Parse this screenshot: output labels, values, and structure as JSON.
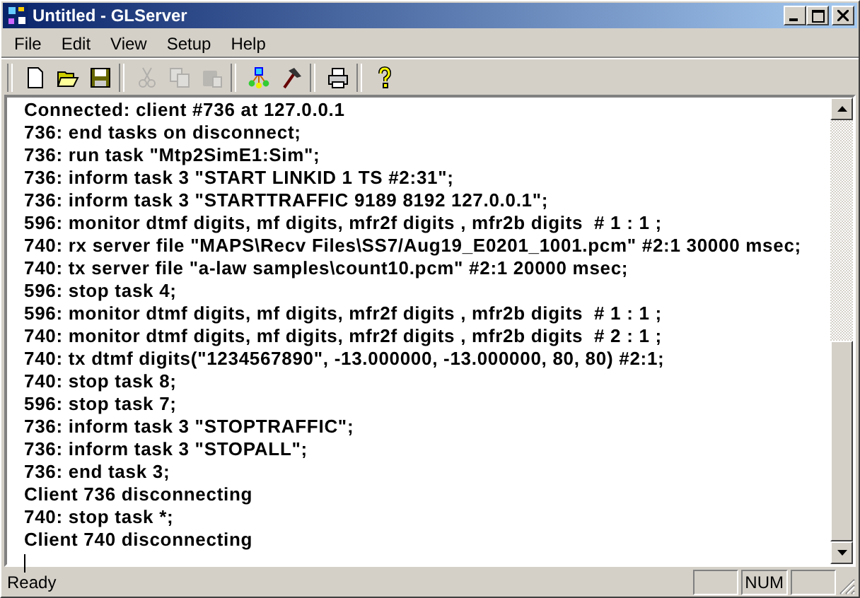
{
  "window": {
    "title": "Untitled - GLServer"
  },
  "menu": [
    "File",
    "Edit",
    "View",
    "Setup",
    "Help"
  ],
  "toolbar": [
    [
      {
        "kind": "new",
        "disabled": false
      },
      {
        "kind": "open",
        "disabled": false
      },
      {
        "kind": "save",
        "disabled": false
      }
    ],
    [
      {
        "kind": "cut",
        "disabled": true
      },
      {
        "kind": "copy",
        "disabled": true
      },
      {
        "kind": "paste",
        "disabled": true
      }
    ],
    [
      {
        "kind": "network",
        "disabled": false
      },
      {
        "kind": "hammer",
        "disabled": false
      }
    ],
    [
      {
        "kind": "print",
        "disabled": false
      }
    ],
    [
      {
        "kind": "help",
        "disabled": false
      }
    ]
  ],
  "log": [
    "Connected: client #736 at 127.0.0.1",
    "736: end tasks on disconnect;",
    "736: run task \"Mtp2SimE1:Sim\";",
    "736: inform task 3 \"START LINKID 1 TS #2:31\";",
    "736: inform task 3 \"STARTTRAFFIC 9189 8192 127.0.0.1\";",
    "596: monitor dtmf digits, mf digits, mfr2f digits , mfr2b digits  # 1 : 1 ;",
    "740: rx server file \"MAPS\\Recv Files\\SS7/Aug19_E0201_1001.pcm\" #2:1 30000 msec;",
    "740: tx server file \"a-law samples\\count10.pcm\" #2:1 20000 msec;",
    "596: stop task 4;",
    "596: monitor dtmf digits, mf digits, mfr2f digits , mfr2b digits  # 1 : 1 ;",
    "740: monitor dtmf digits, mf digits, mfr2f digits , mfr2b digits  # 2 : 1 ;",
    "740: tx dtmf digits(\"1234567890\", -13.000000, -13.000000, 80, 80) #2:1;",
    "740: stop task 8;",
    "596: stop task 7;",
    "736: inform task 3 \"STOPTRAFFIC\";",
    "736: inform task 3 \"STOPALL\";",
    "736: end task 3;",
    "Client 736 disconnecting",
    "740: stop task *;",
    "Client 740 disconnecting"
  ],
  "status_bar": {
    "message": "Ready",
    "indicators": [
      "NUM"
    ]
  }
}
